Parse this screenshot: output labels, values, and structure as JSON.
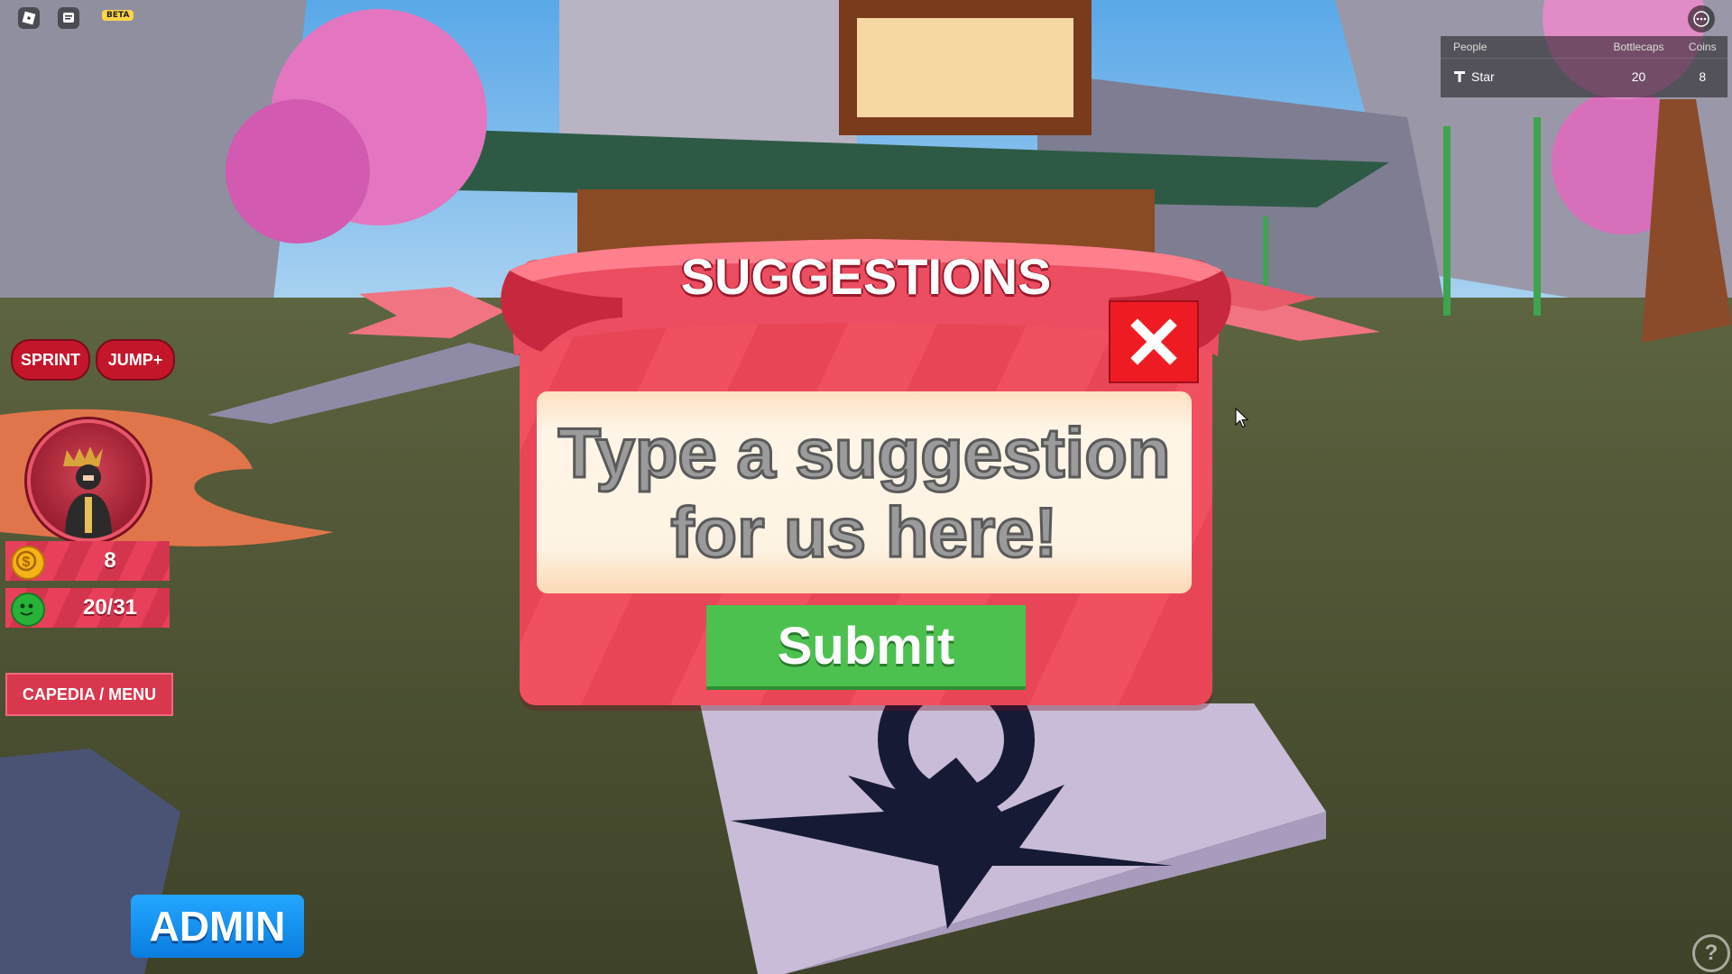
{
  "topbar": {
    "beta_label": "BETA"
  },
  "leaderboard": {
    "headers": [
      "People",
      "Bottlecaps",
      "Coins"
    ],
    "rows": [
      {
        "name": "Star",
        "bottlecaps": "20",
        "coins": "8"
      }
    ]
  },
  "hud": {
    "sprint_label": "SPRINT",
    "jump_label": "JUMP+",
    "coins_value": "8",
    "bottlecaps_value": "20/31",
    "menu_label": "CAPEDIA / MENU",
    "admin_label": "ADMIN"
  },
  "modal": {
    "title": "SUGGESTIONS",
    "placeholder": "Type a suggestion for us here!",
    "submit_label": "Submit"
  },
  "help_label": "?",
  "colors": {
    "modal_red": "#f0505f",
    "close_red": "#ee1b23",
    "submit_green": "#4cc14f",
    "admin_blue": "#1a96f5"
  }
}
